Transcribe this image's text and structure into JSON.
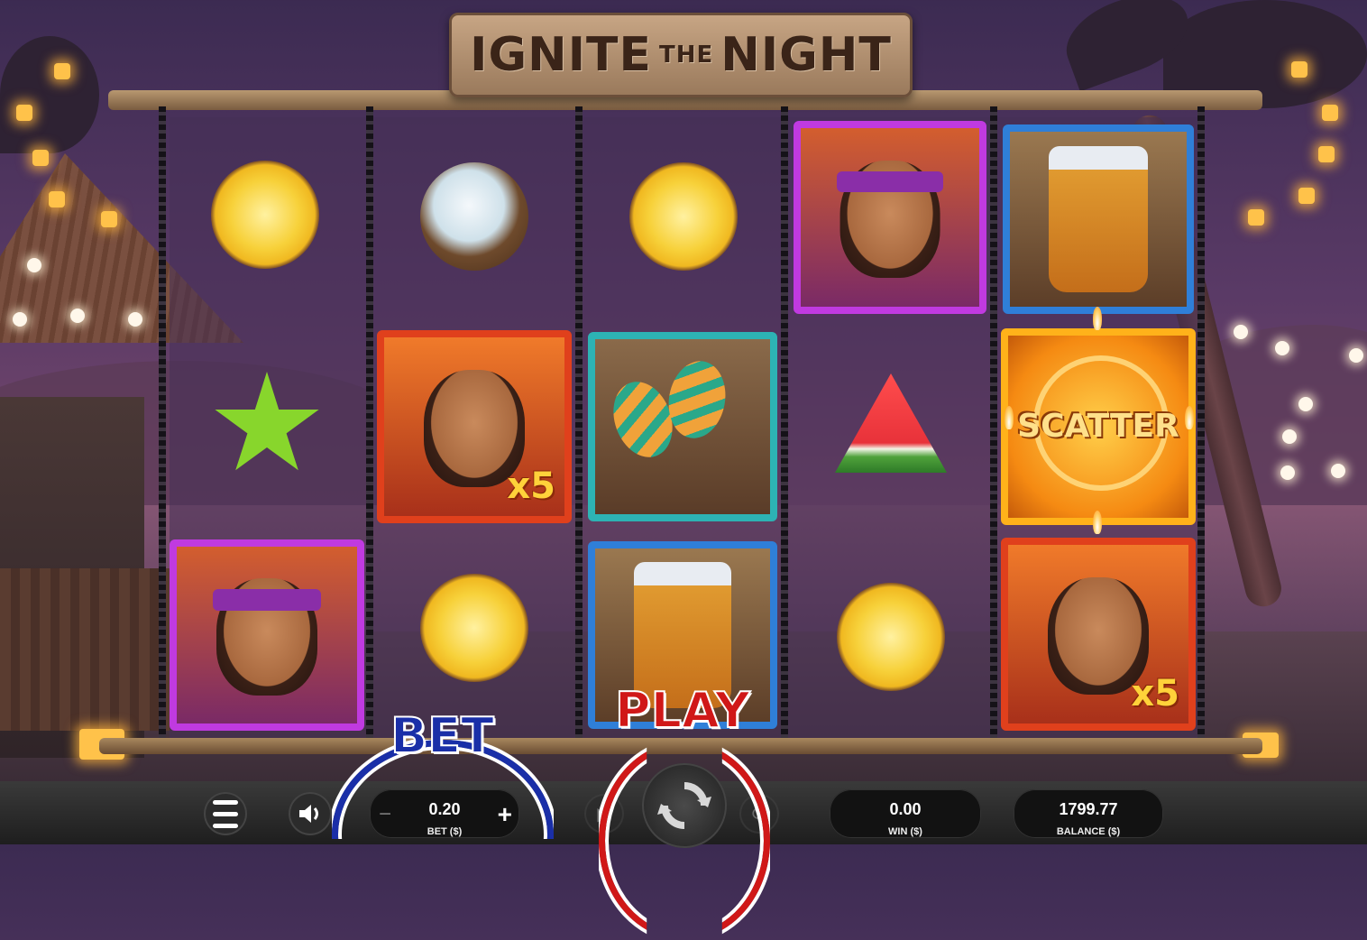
{
  "game": {
    "title_main_1": "IGNITE",
    "title_small": "THE",
    "title_main_2": "NIGHT"
  },
  "reels": [
    [
      "pineapple-symbol",
      "starfruit-symbol",
      "man-symbol"
    ],
    [
      "coconut-symbol",
      "woman-symbol",
      "pineapple-symbol"
    ],
    [
      "pineapple-symbol",
      "maracas-symbol",
      "drum-symbol"
    ],
    [
      "man-symbol",
      "watermelon-symbol",
      "pineapple-symbol"
    ],
    [
      "drum-symbol",
      "scatter-symbol",
      "woman-symbol"
    ]
  ],
  "symbols": {
    "woman_multiplier": "x5",
    "woman_multiplier_2": "x5",
    "scatter_label": "SCATTER"
  },
  "overlay": {
    "bet_label": "BET",
    "play_label": "PLAY"
  },
  "controls": {
    "bet_value": "0.20",
    "bet_label": "BET ($)",
    "minus": "−",
    "plus": "+",
    "win_value": "0.00",
    "win_label": "WIN ($)",
    "balance_value": "1799.77",
    "balance_label": "BALANCE ($)"
  },
  "colors": {
    "bet_overlay": "#1a2fa8",
    "play_overlay": "#d01818"
  }
}
